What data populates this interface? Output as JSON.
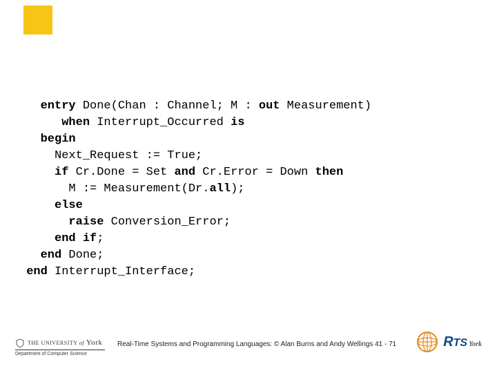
{
  "code": {
    "l1a": "entry",
    "l1b": " Done(Chan : Channel; M : ",
    "l1c": "out",
    "l1d": " Measurement)",
    "l2a": "when",
    "l2b": " Interrupt_Occurred ",
    "l2c": "is",
    "l3a": "begin",
    "l4": "Next_Request := True;",
    "l5a": "if",
    "l5b": " Cr.Done = Set ",
    "l5c": "and",
    "l5d": " Cr.Error = Down ",
    "l5e": "then",
    "l6a": "M := Measurement(Dr.",
    "l6b": "all",
    "l6c": ");",
    "l7a": "else",
    "l8a": "raise",
    "l8b": " Conversion_Error;",
    "l9a": "end if",
    "l9b": ";",
    "l10a": "end",
    "l10b": " Done;",
    "l11a": "end",
    "l11b": " Interrupt_Interface;"
  },
  "footer": {
    "uoy_line1_pre": "THE UNIVERSITY ",
    "uoy_line1_of": "of",
    "uoy_line1_york": " York",
    "uoy_line2": "Department of Computer Science",
    "caption": "Real-Time Systems and Programming Languages: © Alan Burns and Andy Wellings 41 - 71",
    "rts_r": "R",
    "rts_ts": "TS",
    "rts_york": "York"
  }
}
